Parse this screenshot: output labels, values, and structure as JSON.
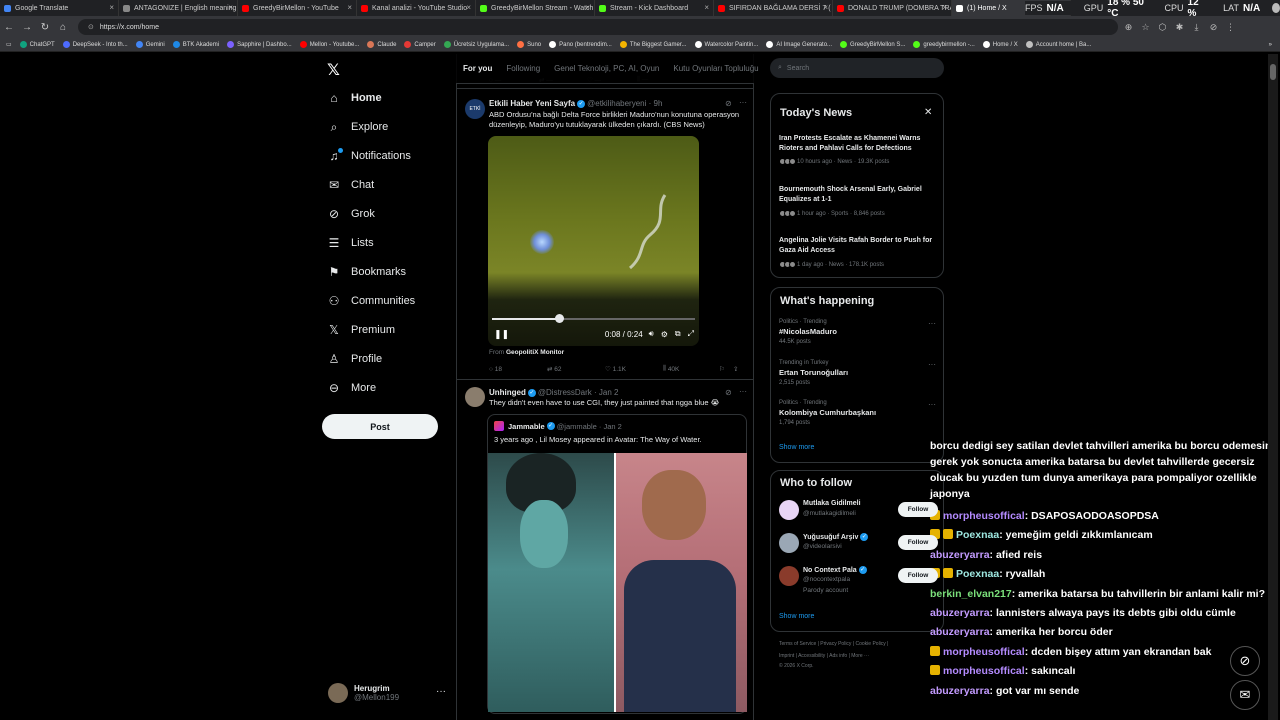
{
  "browser": {
    "tabs": [
      {
        "label": "Google Translate",
        "color": "#4285f4"
      },
      {
        "label": "ANTAGONIZE | English meaning -",
        "color": "#888888"
      },
      {
        "label": "GreedyBirMellon - YouTube",
        "color": "#ff0000"
      },
      {
        "label": "Kanal analizi - YouTube Studio",
        "color": "#ff0000"
      },
      {
        "label": "GreedyBirMellon Stream - Watch",
        "color": "#53fc18"
      },
      {
        "label": "Stream - Kick Dashboard",
        "color": "#53fc18"
      },
      {
        "label": "SIFIRDAN BAĞLAMA DERSİ 7 ( BU",
        "color": "#ff0000"
      },
      {
        "label": "DONALD TRUMP (DOMBRA TRAP",
        "color": "#ff0000"
      },
      {
        "label": "(1) Home / X",
        "color": "#ffffff"
      }
    ],
    "url": "https://x.com/home",
    "bookmarks": [
      "ChatGPT",
      "DeepSeek - Into th...",
      "Gemini",
      "BTK Akademi",
      "Sapphire | Dashbo...",
      "Mellon - Youtube...",
      "Claude",
      "Camper",
      "Ücretsiz Uygulama...",
      "Suno",
      "Pano (bentrendim...",
      "The Biggest Gamer...",
      "Watercolor Paintin...",
      "AI Image Generato...",
      "GreedyBirMellon S...",
      "greedybirmellon -...",
      "Home / X",
      "Account home | Ba..."
    ]
  },
  "hud": {
    "fps_label": "FPS",
    "fps_val": "N/A",
    "gpu_label": "GPU",
    "gpu_val": "18 % 50 °C",
    "cpu_label": "CPU",
    "cpu_val": "12 %",
    "lat_label": "LAT",
    "lat_val": "N/A"
  },
  "nav": {
    "items": [
      "Home",
      "Explore",
      "Notifications",
      "Chat",
      "Grok",
      "Lists",
      "Bookmarks",
      "Communities",
      "Premium",
      "Profile",
      "More"
    ],
    "post": "Post",
    "account_name": "Herugrim",
    "account_handle": "@Mellon199"
  },
  "timeline": {
    "tabs": [
      "For you",
      "Following",
      "Genel Teknoloji, PC, AI, Oyun",
      "Kutu Oyunları Topluluğu"
    ],
    "tweet1": {
      "name": "Etkili Haber Yeni Sayfa",
      "handle": "@etkilihaberyeni · 9h",
      "text": "ABD Ordusu'na bağlı Delta Force birlikleri Maduro'nun konutuna operasyon düzenleyip, Maduro'yu tutuklayarak ülkeden çıkardı. (CBS News)",
      "time": "0:08 / 0:24",
      "from_label": "From",
      "from_source": "GeopolitiX Monitor",
      "replies": "18",
      "reposts": "62",
      "likes": "1.1K",
      "views": "40K",
      "progress": 0.33
    },
    "tweet2": {
      "name": "Unhinged",
      "handle": "@DistressDark · Jan 2",
      "text": "They didn't even have to use CGI, they just painted that ngga blue 😭",
      "quote_name": "Jammable",
      "quote_handle": "@jammable · Jan 2",
      "quote_text": "3 years ago , Lil Mosey appeared in Avatar: The Way of Water."
    }
  },
  "right": {
    "search_placeholder": "Search",
    "news_title": "Today's News",
    "news": [
      {
        "title": "Iran Protests Escalate as Khamenei Warns Rioters and Pahlavi Calls for Defections",
        "meta": "10 hours ago · News · 19.3K posts"
      },
      {
        "title": "Bournemouth Shock Arsenal Early, Gabriel Equalizes at 1-1",
        "meta": "1 hour ago · Sports · 8,846 posts"
      },
      {
        "title": "Angelina Jolie Visits Rafah Border to Push for Gaza Aid Access",
        "meta": "1 day ago · News · 178.1K posts"
      }
    ],
    "happening_title": "What's happening",
    "trends": [
      {
        "cat": "Politics · Trending",
        "name": "#NicolasMaduro",
        "posts": "44.5K posts"
      },
      {
        "cat": "Trending in Turkey",
        "name": "Ertan Torunoğulları",
        "posts": "2,515 posts"
      },
      {
        "cat": "Politics · Trending",
        "name": "Kolombiya Cumhurbaşkanı",
        "posts": "1,794 posts"
      }
    ],
    "show_more": "Show more",
    "wtf_title": "Who to follow",
    "wtf": [
      {
        "name": "Mutlaka Gidilmeli",
        "handle": "@mutlakagidilmeli",
        "extra": ""
      },
      {
        "name": "Yuğusuğuf Arşiv",
        "handle": "@videolarsivi",
        "extra": ""
      },
      {
        "name": "No Context Pala",
        "handle": "@nocontextpala",
        "extra": "Parody account"
      }
    ],
    "follow": "Follow",
    "footer1": "Terms of Service  |  Privacy Policy  |  Cookie Policy  |",
    "footer2": "Imprint  |  Accessibility  |  Ads info  |  More ···",
    "footer3": "© 2026 X Corp."
  },
  "chat": {
    "intro": "borcu dedigi sey satilan devlet tahvilleri amerika bu borcu odemesine gerek yok sonucta amerika batarsa bu devlet tahvillerde gecersiz olucak bu yuzden tum dunya amerikaya para pompaliyor ozellikle japonya",
    "messages": [
      {
        "user": "morpheusoffical",
        "text": ": DSAPOSAODOASOPDSA",
        "badge": true
      },
      {
        "user": "Poexnaa",
        "text": ": yemeğim geldi zıkkımlanıcam",
        "badge": true
      },
      {
        "user": "abuzeryarra",
        "text": ": afied reis",
        "badge": false
      },
      {
        "user": "Poexnaa",
        "text": ": ryvallah",
        "badge": true
      },
      {
        "user": "berkin_elvan217",
        "text": ": amerika batarsa bu tahvillerin bir anlami kalir mi?",
        "badge": false
      },
      {
        "user": "abuzeryarra",
        "text": ": lannisters alwaya pays its debts gibi oldu cümle",
        "badge": false
      },
      {
        "user": "abuzeryarra",
        "text": ": amerika her borcu öder",
        "badge": false
      },
      {
        "user": "morpheusoffical",
        "text": ": dcden bişey attım yan ekrandan bak",
        "badge": true
      },
      {
        "user": "morpheusoffical",
        "text": ": sakıncalı",
        "badge": true
      },
      {
        "user": "abuzeryarra",
        "text": ": got var mı sende",
        "badge": false
      }
    ]
  }
}
